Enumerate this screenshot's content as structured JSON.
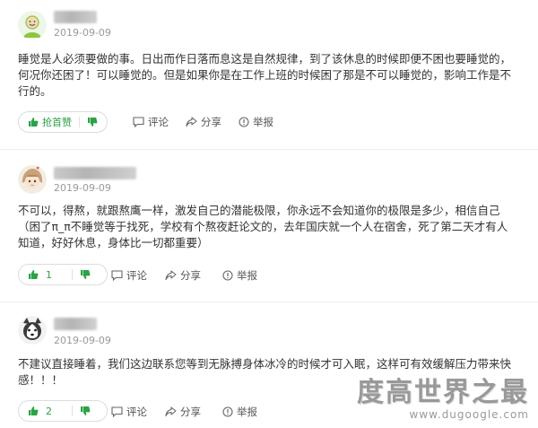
{
  "comments": [
    {
      "date": "2019-09-09",
      "avatar": "smiling-face-avatar",
      "lines": [
        "睡觉是人必须要做的事。日出而作日落而息这是自然规律，到了该休息的时候即便不困也要睡觉的，",
        "何况你还困了！可以睡觉的。但是如果你是在工作上班的时候困了那是不可以睡觉的，影响工作是不",
        "行的。"
      ],
      "like_label": "抢首赞",
      "reply_label": "评论",
      "share_label": "分享",
      "report_label": "举报"
    },
    {
      "date": "2019-09-09",
      "avatar": "anime-girl-avatar",
      "lines": [
        "不可以，得熬，就跟熬鹰一样，激发自己的潜能极限，你永远不会知道你的极限是多少，相信自己",
        "（困了π_π不睡觉等于找死，学校有个熬夜赶论文的，去年国庆就一个人在宿舍，死了第二天才有人",
        "知道，好好休息，身体比一切都重要）"
      ],
      "like_label": "1",
      "reply_label": "评论",
      "share_label": "分享",
      "report_label": "举报"
    },
    {
      "date": "2019-09-09",
      "avatar": "husky-dog-avatar",
      "lines": [
        "不建议直接睡着，我们这边联系您等到无脉搏身体冰冷的时候才可入眠，这样可有效缓解压力带来快",
        "感！！！"
      ],
      "like_label": "2",
      "reply_label": "评论",
      "share_label": "分享",
      "report_label": "举报"
    }
  ],
  "watermark": {
    "main": "度高世界之最",
    "url": "www.dugoogle.com"
  },
  "colors": {
    "accent_green": "#2ba245",
    "text": "#333333",
    "muted": "#9a9a9a",
    "border": "#dcdcdc"
  }
}
